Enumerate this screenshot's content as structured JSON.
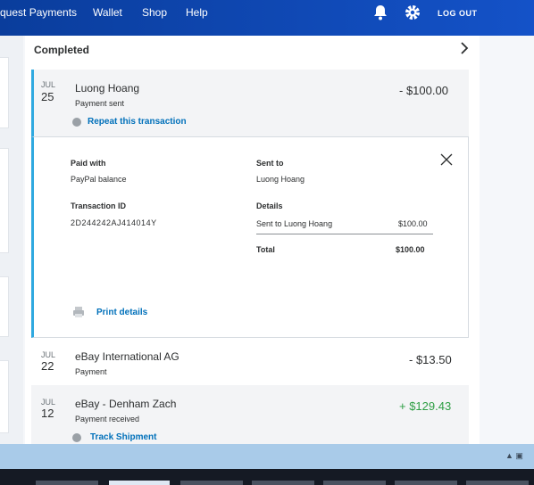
{
  "nav": {
    "items": [
      "quest Payments",
      "Wallet",
      "Shop",
      "Help"
    ],
    "logout": "LOG OUT"
  },
  "activity": {
    "section_title": "Completed",
    "transactions": [
      {
        "month": "JUL",
        "day": "25",
        "name": "Luong Hoang",
        "type": "Payment sent",
        "amount": "- $100.00",
        "action": "Repeat this transaction"
      },
      {
        "month": "JUL",
        "day": "22",
        "name": "eBay International AG",
        "type": "Payment",
        "amount": "- $13.50"
      },
      {
        "month": "JUL",
        "day": "12",
        "name": "eBay - Denham Zach",
        "type": "Payment received",
        "amount": "+ $129.43",
        "action": "Track Shipment"
      }
    ],
    "details": {
      "paid_with_label": "Paid with",
      "paid_with_value": "PayPal balance",
      "sent_to_label": "Sent to",
      "sent_to_value": "Luong Hoang",
      "transaction_id_label": "Transaction ID",
      "transaction_id_value": "2D244242AJ414014Y",
      "details_label": "Details",
      "details_line": "Sent to Luong Hoang",
      "details_line_amount": "$100.00",
      "total_label": "Total",
      "total_amount": "$100.00",
      "print": "Print details"
    }
  },
  "colors": {
    "nav_bg": "#1452c8",
    "accent_bar": "#2fa9e0",
    "link": "#0070ba",
    "positive": "#2e9e44"
  },
  "icons": [
    "bell-icon",
    "gear-icon",
    "chevron-right-icon",
    "close-icon",
    "print-icon",
    "repeat-icon",
    "shipment-icon"
  ]
}
